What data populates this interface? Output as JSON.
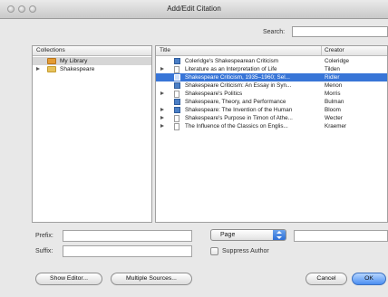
{
  "window": {
    "title": "Add/Edit Citation"
  },
  "search": {
    "label": "Search:",
    "value": ""
  },
  "collections": {
    "header": "Collections",
    "items": [
      {
        "label": "My Library",
        "selected": true,
        "icon": "library-folder-icon"
      },
      {
        "label": "Shakespeare",
        "selected": false,
        "icon": "folder-icon",
        "expandable": true
      }
    ]
  },
  "items": {
    "columns": {
      "title": "Title",
      "creator": "Creator"
    },
    "rows": [
      {
        "title": "Coleridge's Shakespearean Criticism",
        "creator": "Coleridge",
        "icon": "book-icon",
        "expandable": false,
        "selected": false
      },
      {
        "title": "Literature as an Interpretation of Life",
        "creator": "Tilden",
        "icon": "page-icon",
        "expandable": true,
        "selected": false
      },
      {
        "title": "Shakespeare Criticism, 1935–1960; Sel...",
        "creator": "Ridler",
        "icon": "book-icon",
        "expandable": false,
        "selected": true
      },
      {
        "title": "Shakespeare Criticism: An Essay in Syn...",
        "creator": "Menon",
        "icon": "book-icon",
        "expandable": false,
        "selected": false
      },
      {
        "title": "Shakespeare's Politics",
        "creator": "Morris",
        "icon": "page-icon",
        "expandable": true,
        "selected": false
      },
      {
        "title": "Shakespeare, Theory, and Performance",
        "creator": "Bulman",
        "icon": "book-icon",
        "expandable": false,
        "selected": false
      },
      {
        "title": "Shakespeare: The Invention of the Human",
        "creator": "Bloom",
        "icon": "book-icon",
        "expandable": true,
        "selected": false
      },
      {
        "title": "Shakespeare's Purpose in Timon of Athe...",
        "creator": "Wecter",
        "icon": "page-icon",
        "expandable": true,
        "selected": false
      },
      {
        "title": "The Influence of the Classics on Englis...",
        "creator": "Kraemer",
        "icon": "page-icon",
        "expandable": true,
        "selected": false
      }
    ]
  },
  "citation": {
    "prefix_label": "Prefix:",
    "prefix_value": "",
    "suffix_label": "Suffix:",
    "suffix_value": "",
    "locator_selected": "Page",
    "locator_value": "",
    "suppress_author_label": "Suppress Author",
    "suppress_author_checked": false
  },
  "buttons": {
    "show_editor": "Show Editor...",
    "multiple_sources": "Multiple Sources...",
    "cancel": "Cancel",
    "ok": "OK"
  }
}
